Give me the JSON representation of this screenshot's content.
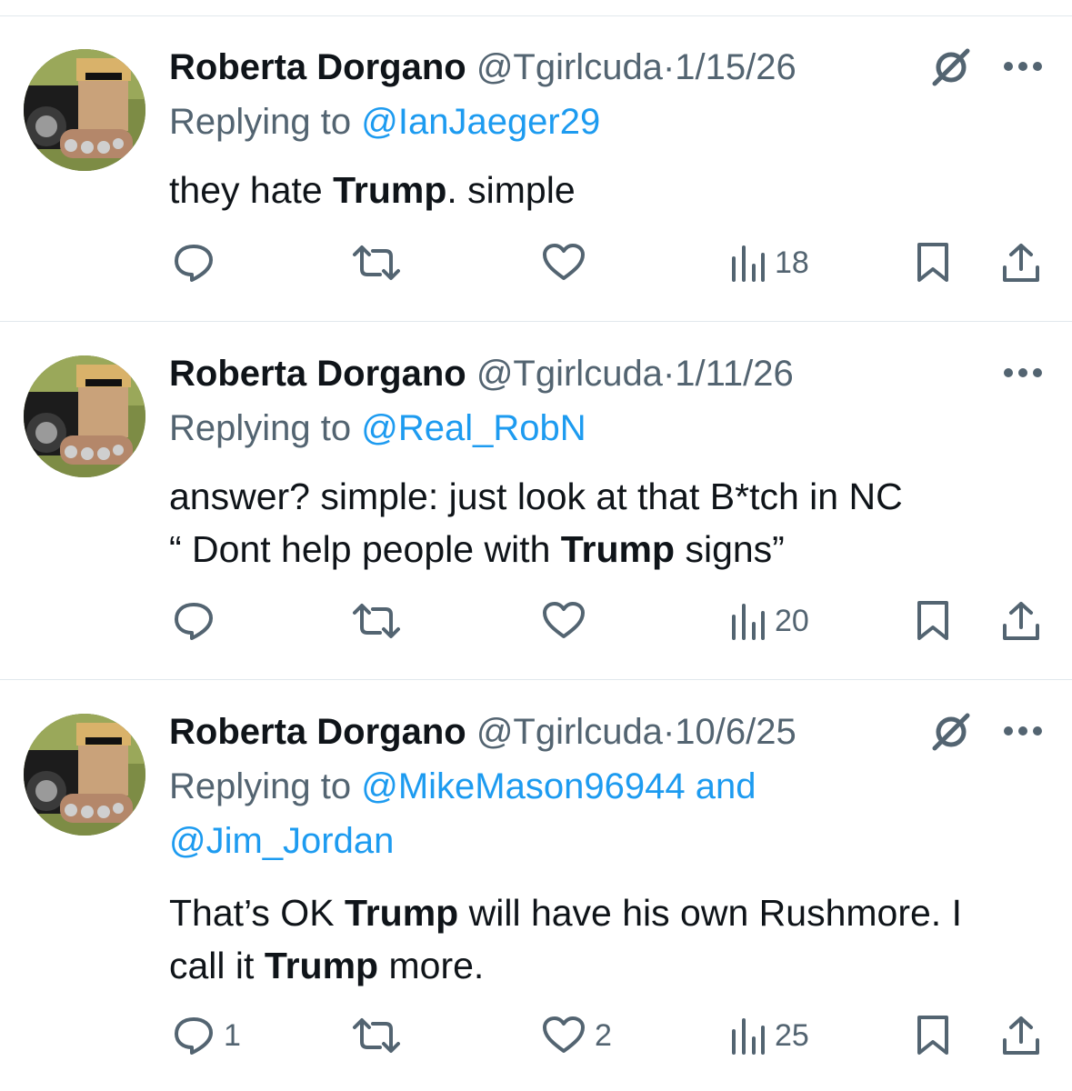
{
  "colors": {
    "text": "#0f1419",
    "secondary": "#536471",
    "link": "#1d9bf0",
    "divider": "#e1e8ed"
  },
  "tweets": [
    {
      "name": "Roberta Dorgano",
      "handle": "@Tgirlcuda",
      "dot": "·",
      "date": "1/15/26",
      "replying_prefix": "Replying to ",
      "replying_to": "@IanJaeger29",
      "replying_to_2": "",
      "show_grok": true,
      "body": {
        "t1": "they hate ",
        "b1": "Trump",
        "t2": ". simple"
      },
      "stats": {
        "replies": "",
        "reposts": "",
        "likes": "",
        "views": "18"
      }
    },
    {
      "name": "Roberta Dorgano",
      "handle": "@Tgirlcuda",
      "dot": "·",
      "date": "1/11/26",
      "replying_prefix": "Replying to ",
      "replying_to": "@Real_RobN",
      "replying_to_2": "",
      "show_grok": false,
      "body": {
        "l1": "answer? simple: just look at that B*tch in NC",
        "t1": "“ Dont help people with ",
        "b1": "Trump",
        "t2": " signs”"
      },
      "stats": {
        "replies": "",
        "reposts": "",
        "likes": "",
        "views": "20"
      }
    },
    {
      "name": "Roberta Dorgano",
      "handle": "@Tgirlcuda",
      "dot": "·",
      "date": "10/6/25",
      "replying_prefix": "Replying to ",
      "replying_to": "@MikeMason96944 and",
      "replying_to_2": "@Jim_Jordan",
      "show_grok": true,
      "body": {
        "t1": "That’s OK ",
        "b1": "Trump",
        "t2": " will have his own Rushmore. I",
        "t3": "call it ",
        "b2": "Trump",
        "t4": " more."
      },
      "stats": {
        "replies": "1",
        "reposts": "",
        "likes": "2",
        "views": "25"
      }
    }
  ],
  "icons": [
    "reply-icon",
    "repost-icon",
    "like-icon",
    "views-icon",
    "bookmark-icon",
    "share-icon",
    "grok-icon",
    "more-icon"
  ]
}
